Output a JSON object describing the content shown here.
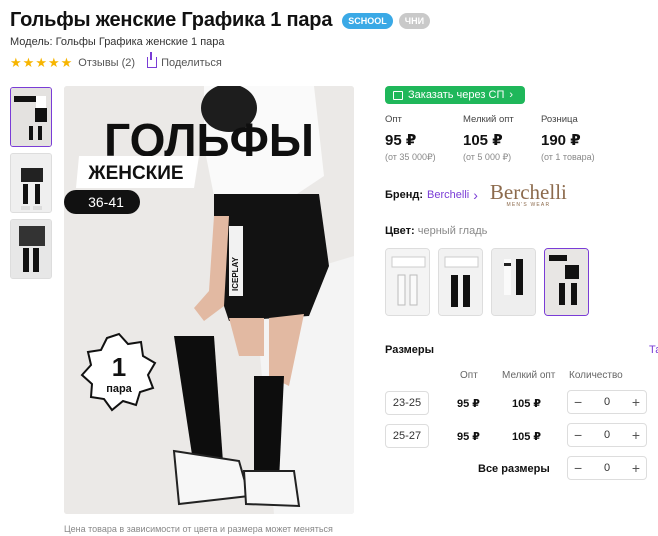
{
  "product": {
    "title": "Гольфы женские Графика 1 пара",
    "badges": [
      "SCHOOL",
      "ЧНИ"
    ],
    "model": "Модель: Гольфы Графика женские 1 пара",
    "rating_stars": 5,
    "reviews": "Отзывы (2)",
    "share": "Поделиться"
  },
  "image": {
    "headline": "ГОЛЬФЫ",
    "subtitle": "ЖЕНСКИЕ",
    "size_range": "36-41",
    "badge_number": "1",
    "badge_word": "пара",
    "print_text": "ICEPLAY",
    "caption": "Цена товара в зависимости от цвета и размера может меняться"
  },
  "order_button": "Заказать через СП",
  "prices": [
    {
      "label": "Опт",
      "value": "95 ₽",
      "note": "(от 35 000₽)"
    },
    {
      "label": "Мелкий опт",
      "value": "105 ₽",
      "note": "(от 5 000 ₽)"
    },
    {
      "label": "Розница",
      "value": "190 ₽",
      "note": "(от 1 товара)"
    }
  ],
  "brand": {
    "label": "Бренд:",
    "name": "Berchelli",
    "logo_text": "Berchelli",
    "logo_sub": "MEN'S WEAR"
  },
  "color": {
    "label": "Цвет:",
    "value": "черный гладь"
  },
  "sizes": {
    "heading": "Размеры",
    "tab": "Та",
    "columns": {
      "opt": "Опт",
      "small_opt": "Мелкий опт",
      "qty": "Количество"
    },
    "rows": [
      {
        "size": "23-25",
        "opt": "95 ₽",
        "small_opt": "105 ₽",
        "qty": "0"
      },
      {
        "size": "25-27",
        "opt": "95 ₽",
        "small_opt": "105 ₽",
        "qty": "0"
      }
    ],
    "all_label": "Все размеры",
    "all_qty": "0",
    "minus": "−",
    "plus": "+"
  },
  "colors": {
    "accent": "#7a3cd6",
    "green": "#1fb75a",
    "star": "#f7b500",
    "school": "#3aa9e6"
  }
}
